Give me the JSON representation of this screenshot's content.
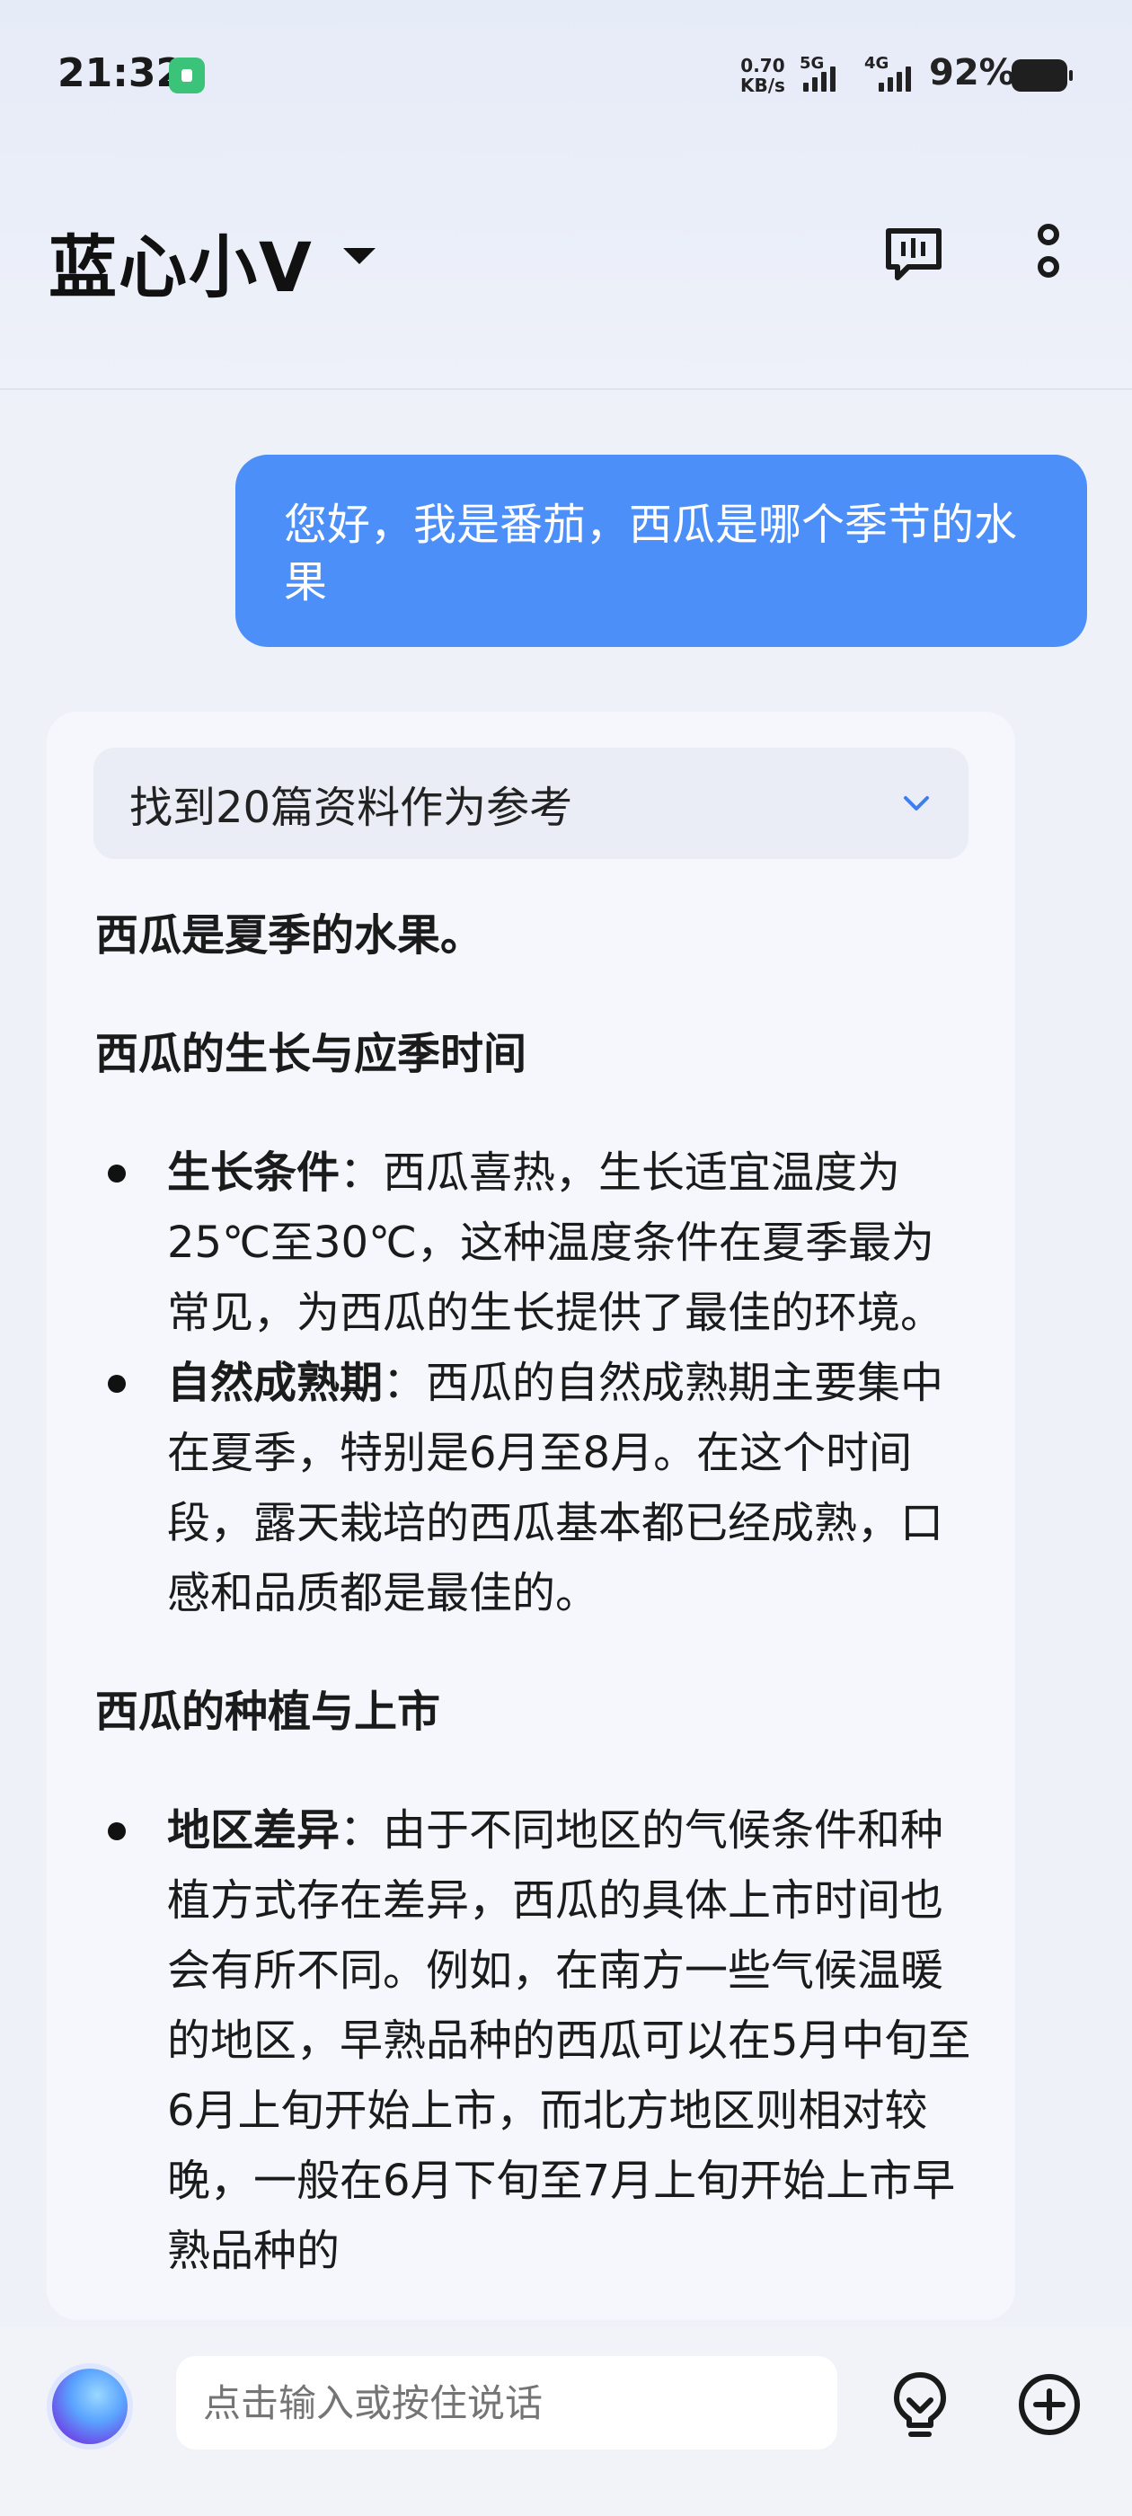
{
  "status_bar": {
    "time": "21:32",
    "net_speed_value": "0.70",
    "net_speed_unit": "KB/s",
    "sim1": "5G",
    "sim2": "4G",
    "battery": "92%"
  },
  "header": {
    "title": "蓝心小V"
  },
  "conversation": {
    "user_message": "您好，我是番茄，西瓜是哪个季节的水果",
    "references_label": "找到20篇资料作为参考",
    "answer": {
      "summary": "西瓜是夏季的水果。",
      "section1_title": "西瓜的生长与应季时间",
      "section1_items": [
        {
          "term": "生长条件",
          "sep": "：",
          "text": "西瓜喜热，生长适宜温度为25℃至30℃，这种温度条件在夏季最为常见，为西瓜的生长提供了最佳的环境。"
        },
        {
          "term": "自然成熟期",
          "sep": "：",
          "text": "西瓜的自然成熟期主要集中在夏季，特别是6月至8月。在这个时间段，露天栽培的西瓜基本都已经成熟，口感和品质都是最佳的。"
        }
      ],
      "section2_title": "西瓜的种植与上市",
      "section2_items": [
        {
          "term": "地区差异",
          "sep": "：",
          "text": "由于不同地区的气候条件和种植方式存在差异，西瓜的具体上市时间也会有所不同。例如，在南方一些气候温暖的地区，早熟品种的西瓜可以在5月中旬至6月上旬开始上市，而北方地区则相对较晚，一般在6月下旬至7月上旬开始上市早熟品种的"
        }
      ]
    }
  },
  "input_bar": {
    "placeholder": "点击输入或按住说话"
  },
  "icons": {
    "feedback": "chat-feedback-icon",
    "more": "more-vertical-icon",
    "assistant": "assistant-orb-icon",
    "inspiration": "lightbulb-icon",
    "add": "add-circle-icon"
  },
  "colors": {
    "user_bubble": "#4d8ff8",
    "reference_chevron": "#3d7ff0",
    "hotspot_badge": "#3cc37a"
  }
}
